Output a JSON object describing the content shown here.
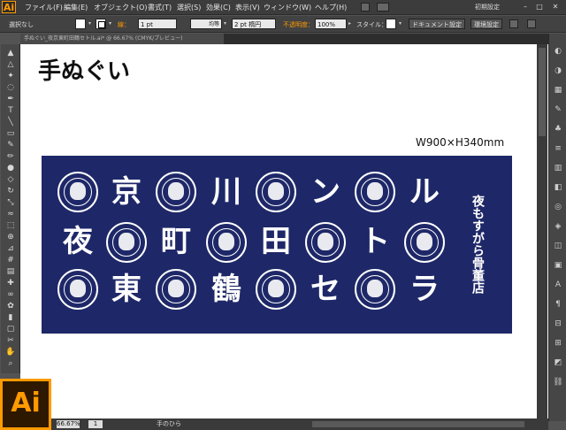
{
  "app": {
    "logo": "Ai"
  },
  "menu": [
    "ファイル(F)",
    "編集(E)",
    "オブジェクト(O)",
    "書式(T)",
    "選択(S)",
    "効果(C)",
    "表示(V)",
    "ウィンドウ(W)",
    "ヘルプ(H)"
  ],
  "workspace": "初期設定",
  "control": {
    "selection_label": "選択なし",
    "stroke_label": "線：",
    "stroke_value": "1 pt",
    "line_style": "均等",
    "brush": "2 pt 楕円",
    "opacity_label": "不透明度：",
    "opacity_value": "100%",
    "style_label": "スタイル：",
    "doc_settings": "ドキュメント設定",
    "prefs": "環境設定"
  },
  "tab": {
    "title": "手ぬぐい_夜京東町田鶴セトル.ai* @ 66.67% (CMYK/プレビュー)"
  },
  "artboard": {
    "title": "手ぬぐい",
    "dimension": "W900×H340mm",
    "shop_name": "夜もすがら骨董店"
  },
  "towel_chars": [
    "夜",
    "京",
    "東",
    "町",
    "川",
    "鶴",
    "田",
    "ン",
    "セ",
    "ト",
    "ル",
    "ラ"
  ],
  "status": {
    "zoom": "66.67%",
    "artboard_num": "1",
    "tool_name": "手のひら"
  },
  "colors": {
    "towel": "#1e2868",
    "accent": "#ff9a00"
  },
  "toolbar_icons": [
    "selection-icon",
    "direct-selection-icon",
    "magic-wand-icon",
    "lasso-icon",
    "pen-icon",
    "type-icon",
    "line-icon",
    "rectangle-icon",
    "paintbrush-icon",
    "pencil-icon",
    "blob-brush-icon",
    "eraser-icon",
    "rotate-icon",
    "scale-icon",
    "warp-icon",
    "free-transform-icon",
    "shape-builder-icon",
    "perspective-icon",
    "mesh-icon",
    "gradient-icon",
    "eyedropper-icon",
    "blend-icon",
    "symbol-sprayer-icon",
    "graph-icon",
    "artboard-icon",
    "slice-icon",
    "hand-icon",
    "zoom-icon"
  ]
}
